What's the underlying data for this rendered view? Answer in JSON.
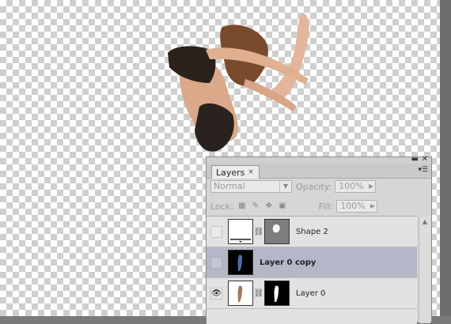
{
  "panel": {
    "tab_label": "Layers",
    "tab_close": "×",
    "titlebar_icons": [
      "minimize-icon",
      "close-icon"
    ],
    "menu_icon": "panel-menu-icon",
    "blend_mode": "Normal",
    "opacity_label": "Opacity:",
    "opacity_value": "100%",
    "lock_label": "Lock:",
    "fill_label": "Fill:",
    "fill_value": "100%"
  },
  "layers": [
    {
      "name": "Shape 2",
      "visible": false,
      "selected": false,
      "has_mask": true
    },
    {
      "name": "Layer 0 copy",
      "visible": false,
      "selected": true,
      "has_mask": false
    },
    {
      "name": "Layer 0",
      "visible": true,
      "selected": false,
      "has_mask": true
    }
  ],
  "colors": {
    "selected_row": "#b3b7c7",
    "panel_bg": "#d6d6d6"
  }
}
